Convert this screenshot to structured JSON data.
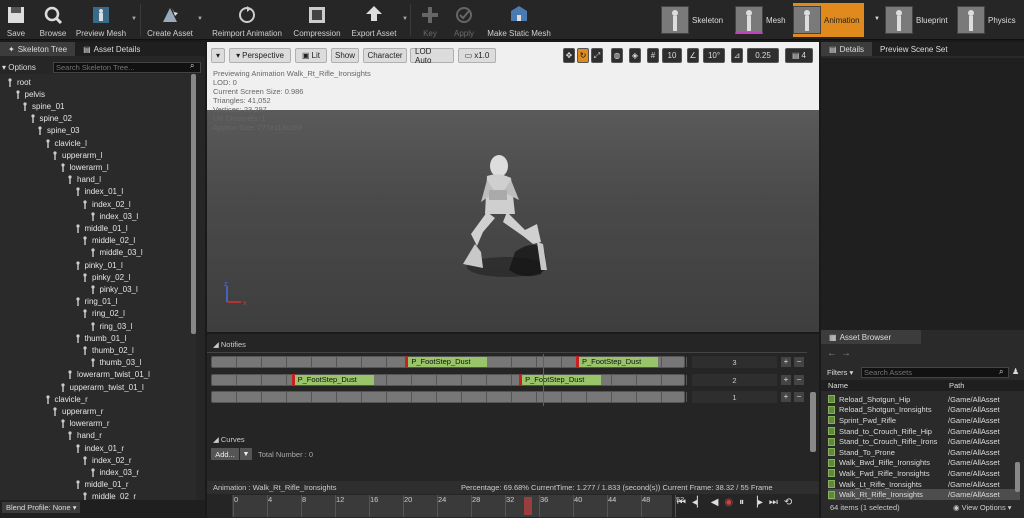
{
  "toolbar": {
    "save": "Save",
    "browse": "Browse",
    "preview_mesh": "Preview Mesh",
    "create_asset": "Create Asset",
    "reimport": "Reimport Animation",
    "compression": "Compression",
    "export": "Export Asset",
    "key": "Key",
    "apply": "Apply",
    "make_static": "Make Static Mesh"
  },
  "modes": {
    "skeleton": "Skeleton",
    "mesh": "Mesh",
    "animation": "Animation",
    "blueprint": "Blueprint",
    "physics": "Physics"
  },
  "left": {
    "tab_tree": "Skeleton Tree",
    "tab_asset": "Asset Details",
    "options": "Options",
    "search_placeholder": "Search Skeleton Tree...",
    "blend_profile": "Blend Profile: None",
    "bones": [
      {
        "n": "root",
        "d": 0
      },
      {
        "n": "pelvis",
        "d": 1
      },
      {
        "n": "spine_01",
        "d": 2
      },
      {
        "n": "spine_02",
        "d": 3
      },
      {
        "n": "spine_03",
        "d": 4
      },
      {
        "n": "clavicle_l",
        "d": 5
      },
      {
        "n": "upperarm_l",
        "d": 6
      },
      {
        "n": "lowerarm_l",
        "d": 7
      },
      {
        "n": "hand_l",
        "d": 8
      },
      {
        "n": "index_01_l",
        "d": 9
      },
      {
        "n": "index_02_l",
        "d": 10
      },
      {
        "n": "index_03_l",
        "d": 11
      },
      {
        "n": "middle_01_l",
        "d": 9
      },
      {
        "n": "middle_02_l",
        "d": 10
      },
      {
        "n": "middle_03_l",
        "d": 11
      },
      {
        "n": "pinky_01_l",
        "d": 9
      },
      {
        "n": "pinky_02_l",
        "d": 10
      },
      {
        "n": "pinky_03_l",
        "d": 11
      },
      {
        "n": "ring_01_l",
        "d": 9
      },
      {
        "n": "ring_02_l",
        "d": 10
      },
      {
        "n": "ring_03_l",
        "d": 11
      },
      {
        "n": "thumb_01_l",
        "d": 9
      },
      {
        "n": "thumb_02_l",
        "d": 10
      },
      {
        "n": "thumb_03_l",
        "d": 11
      },
      {
        "n": "lowerarm_twist_01_l",
        "d": 8
      },
      {
        "n": "upperarm_twist_01_l",
        "d": 7
      },
      {
        "n": "clavicle_r",
        "d": 5
      },
      {
        "n": "upperarm_r",
        "d": 6
      },
      {
        "n": "lowerarm_r",
        "d": 7
      },
      {
        "n": "hand_r",
        "d": 8
      },
      {
        "n": "index_01_r",
        "d": 9
      },
      {
        "n": "index_02_r",
        "d": 10
      },
      {
        "n": "index_03_r",
        "d": 11
      },
      {
        "n": "middle_01_r",
        "d": 9
      },
      {
        "n": "middle_02_r",
        "d": 10
      }
    ]
  },
  "viewport": {
    "perspective": "Perspective",
    "lit": "Lit",
    "show": "Show",
    "character": "Character",
    "lod": "LOD Auto",
    "speed": "x1.0",
    "grid": "10",
    "angle": "10°",
    "scale": "0.25",
    "cams": "4",
    "stats": [
      "Previewing Animation Walk_Rt_Rifle_Ironsights",
      "LOD: 0",
      "Current Screen Size: 0.986",
      "Triangles: 41,052",
      "Vertices: 23,297",
      "UV Channels: 1",
      "Approx Size: 277x113x263"
    ]
  },
  "notifies": {
    "header": "Notifies",
    "tracks": [
      "3",
      "2",
      "1"
    ],
    "events": [
      {
        "label": "P_FootStep_Dust",
        "track": 0,
        "start": 0.41
      },
      {
        "label": "P_FootStep_Dust",
        "track": 0,
        "start": 0.77
      },
      {
        "label": "P_FootStep_Dust",
        "track": 1,
        "start": 0.17
      },
      {
        "label": "P_FootStep_Dust",
        "track": 1,
        "start": 0.65
      }
    ],
    "curves": "Curves",
    "add": "Add...",
    "total": "Total Number : 0"
  },
  "status": {
    "animation": "Animation :  Walk_Rt_Rifle_Ironsights",
    "percentage": "Percentage:  69.68% CurrentTime:  1.277 / 1.833 (second(s)) Current Frame:  38.32 / 55 Frame"
  },
  "ruler": [
    "0",
    "4",
    "8",
    "12",
    "16",
    "20",
    "24",
    "28",
    "32",
    "36",
    "40",
    "44",
    "48",
    "52"
  ],
  "details": {
    "tab": "Details",
    "tab2": "Preview Scene Set"
  },
  "assets": {
    "tab": "Asset Browser",
    "filters": "Filters",
    "search_placeholder": "Search Assets",
    "col_name": "Name",
    "col_path": "Path",
    "items": [
      {
        "name": "Reload_Shotgun_Hip",
        "path": "/Game/AllAsset"
      },
      {
        "name": "Reload_Shotgun_Ironsights",
        "path": "/Game/AllAsset"
      },
      {
        "name": "Sprint_Fwd_Rifle",
        "path": "/Game/AllAsset"
      },
      {
        "name": "Stand_to_Crouch_Rifle_Hip",
        "path": "/Game/AllAsset"
      },
      {
        "name": "Stand_to_Crouch_Rifle_Irons",
        "path": "/Game/AllAsset"
      },
      {
        "name": "Stand_To_Prone",
        "path": "/Game/AllAsset"
      },
      {
        "name": "Walk_Bwd_Rifle_Ironsights",
        "path": "/Game/AllAsset"
      },
      {
        "name": "Walk_Fwd_Rifle_Ironsights",
        "path": "/Game/AllAsset"
      },
      {
        "name": "Walk_Lt_Rifle_Ironsights",
        "path": "/Game/AllAsset"
      },
      {
        "name": "Walk_Rt_Rifle_Ironsights",
        "path": "/Game/AllAsset"
      }
    ],
    "count": "64 items (1 selected)",
    "view_options": "View Options"
  }
}
